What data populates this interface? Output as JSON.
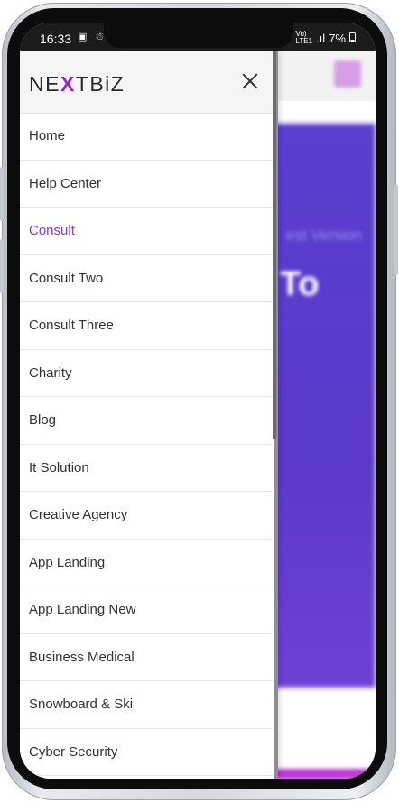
{
  "status_bar": {
    "time": "16:33",
    "left_icons": "▣ ☃ ⚲",
    "network_top": "Vo)",
    "network_bottom": "LTE1",
    "signal": ".ıl",
    "battery_percent": "7%"
  },
  "background_page": {
    "hero_subtitle": "est Version",
    "hero_title": "To",
    "hero_color": "#5a3fd0"
  },
  "drawer": {
    "logo_prefix": "NE",
    "logo_accent": "X",
    "logo_suffix": "TBiZ",
    "close_icon": "close-icon",
    "accent_color": "#9b20d9",
    "active_index": 2,
    "items": [
      {
        "label": "Home"
      },
      {
        "label": "Help Center"
      },
      {
        "label": "Consult"
      },
      {
        "label": "Consult Two"
      },
      {
        "label": "Consult Three"
      },
      {
        "label": "Charity"
      },
      {
        "label": "Blog"
      },
      {
        "label": "It Solution"
      },
      {
        "label": "Creative Agency"
      },
      {
        "label": "App Landing"
      },
      {
        "label": "App Landing New"
      },
      {
        "label": "Business Medical"
      },
      {
        "label": "Snowboard & Ski"
      },
      {
        "label": "Cyber Security"
      }
    ]
  }
}
